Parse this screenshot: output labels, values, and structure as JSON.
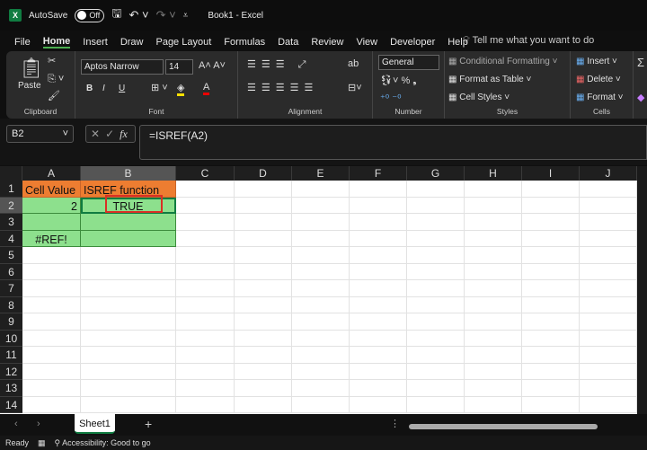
{
  "titlebar": {
    "autosave": "AutoSave",
    "toggle": "Off",
    "title": "Book1  -  Excel"
  },
  "tabs": [
    "File",
    "Home",
    "Insert",
    "Draw",
    "Page Layout",
    "Formulas",
    "Data",
    "Review",
    "View",
    "Developer",
    "Help"
  ],
  "tell_me": "Tell me what you want to do",
  "ribbon": {
    "paste": "Paste",
    "clipboard": "Clipboard",
    "font_name": "Aptos Narrow",
    "font_size": "14",
    "font": "Font",
    "alignment": "Alignment",
    "number_format": "General",
    "number": "Number",
    "conditional": "Conditional Formatting",
    "format_table": "Format as Table",
    "cell_styles": "Cell Styles",
    "styles": "Styles",
    "insert": "Insert",
    "delete": "Delete",
    "format": "Format",
    "cells": "Cells",
    "bold": "B",
    "italic": "I",
    "underline": "U"
  },
  "name_box": "B2",
  "formula": "=ISREF(A2)",
  "columns": [
    "A",
    "B",
    "C",
    "D",
    "E",
    "F",
    "G",
    "H",
    "I",
    "J"
  ],
  "rows": [
    "1",
    "2",
    "3",
    "4",
    "5",
    "6",
    "7",
    "8",
    "9",
    "10",
    "11",
    "12",
    "13",
    "14"
  ],
  "selected_cell": "B2",
  "cells": {
    "A1": "Cell Value",
    "B1": "ISREF function",
    "A2": "2",
    "B2": "TRUE",
    "A4": "#REF!"
  },
  "colors": {
    "header_fill": "#ed7d31",
    "data_fill": "#8de08d",
    "highlight_border": "#d93025",
    "accent": "#107c41"
  },
  "sheets": [
    "Sheet1"
  ],
  "status": {
    "ready": "Ready",
    "accessibility": "Accessibility: Good to go"
  }
}
